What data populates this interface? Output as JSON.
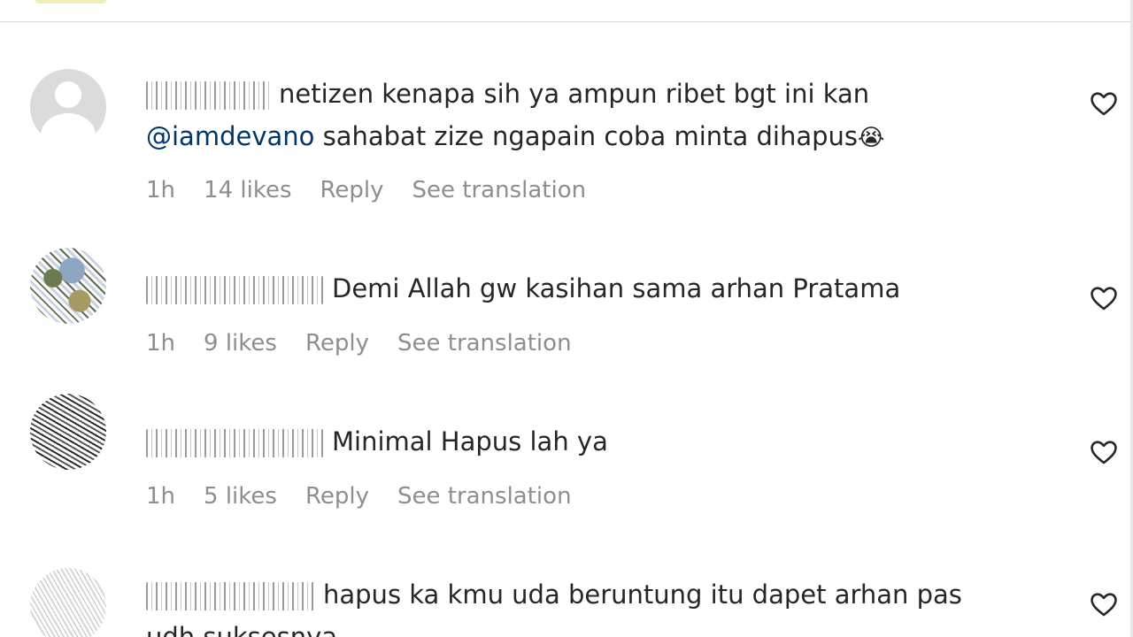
{
  "comments": [
    {
      "text": "netizen kenapa sih ya ampun ribet bgt ini kan",
      "mention": "@iamdevano",
      "text2": " sahabat zize ngapain coba minta dihapus",
      "emoji": "😭",
      "time": "1h",
      "likes": "14 likes",
      "reply": "Reply",
      "translate": "See translation"
    },
    {
      "text": "Demi Allah gw kasihan sama arhan Pratama",
      "time": "1h",
      "likes": "9 likes",
      "reply": "Reply",
      "translate": "See translation"
    },
    {
      "text": "Minimal Hapus lah ya",
      "time": "1h",
      "likes": "5 likes",
      "reply": "Reply",
      "translate": "See translation"
    },
    {
      "text": "hapus ka kmu uda beruntung itu dapet arhan pas",
      "text2": "udh suksesnya"
    }
  ],
  "icons": {
    "like": "heart-outline-icon",
    "avatar_default": "default-avatar-icon"
  },
  "colors": {
    "text": "#262626",
    "meta": "#8e8e8e",
    "mention": "#00376b",
    "divider": "#dbdbdb"
  }
}
